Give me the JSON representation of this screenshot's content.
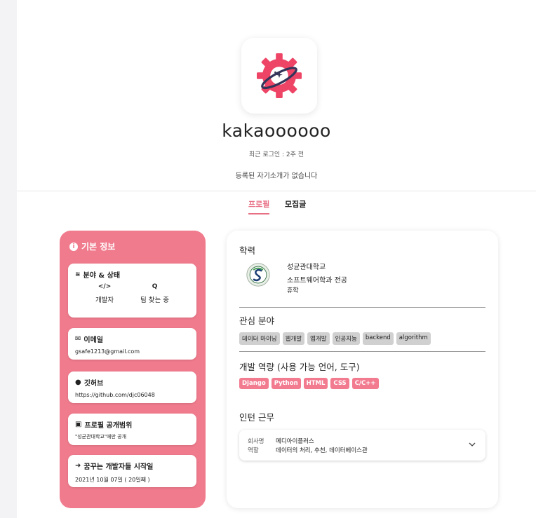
{
  "profile": {
    "username": "kakaoooooo",
    "last_login": "최근 로그인 : 2주 전",
    "intro": "등록된 자기소개가 없습니다"
  },
  "tabs": [
    {
      "label": "프로필",
      "active": true
    },
    {
      "label": "모집글",
      "active": false
    }
  ],
  "basic_info": {
    "title": "기본 정보",
    "field_status": {
      "title": "분야 & 상태",
      "items": [
        {
          "icon": "code-icon",
          "glyph": "</>",
          "label": "개발자"
        },
        {
          "icon": "search-icon",
          "glyph": "Q",
          "label": "팀 찾는 중"
        }
      ]
    },
    "email": {
      "title": "이메일",
      "value": "gsafe1213@gmail.com"
    },
    "github": {
      "title": "깃허브",
      "value": "https://github.com/djc06048"
    },
    "visibility": {
      "title": "프로필 공개범위",
      "value": "\"성균관대학교\"에만 공개"
    },
    "start_date": {
      "title": "꿈꾸는 개발자들 시작일",
      "value": "2021년 10월 07일 ( 20일째 )"
    }
  },
  "education": {
    "title": "학력",
    "school": "성균관대학교",
    "major": "소프트웨어학과 전공",
    "status": "휴학"
  },
  "interests": {
    "title": "관심 분야",
    "tags": [
      "데이터 마이닝",
      "웹개발",
      "앱개발",
      "인공지능",
      "backend",
      "algorithm"
    ]
  },
  "skills": {
    "title": "개발 역량 (사용 가능 언어, 도구)",
    "tags": [
      "Django",
      "Python",
      "HTML",
      "CSS",
      "C/C++"
    ]
  },
  "intern": {
    "title": "인턴 근무",
    "company_label": "회사명",
    "company": "메디아이플러스",
    "role_label": "역할",
    "role": "데이터의 처리, 추천, 데이터베이스관"
  },
  "colors": {
    "accent": "#f07b8d",
    "tag_gray": "#d0d0d0",
    "tag_pink": "#f27b90"
  }
}
